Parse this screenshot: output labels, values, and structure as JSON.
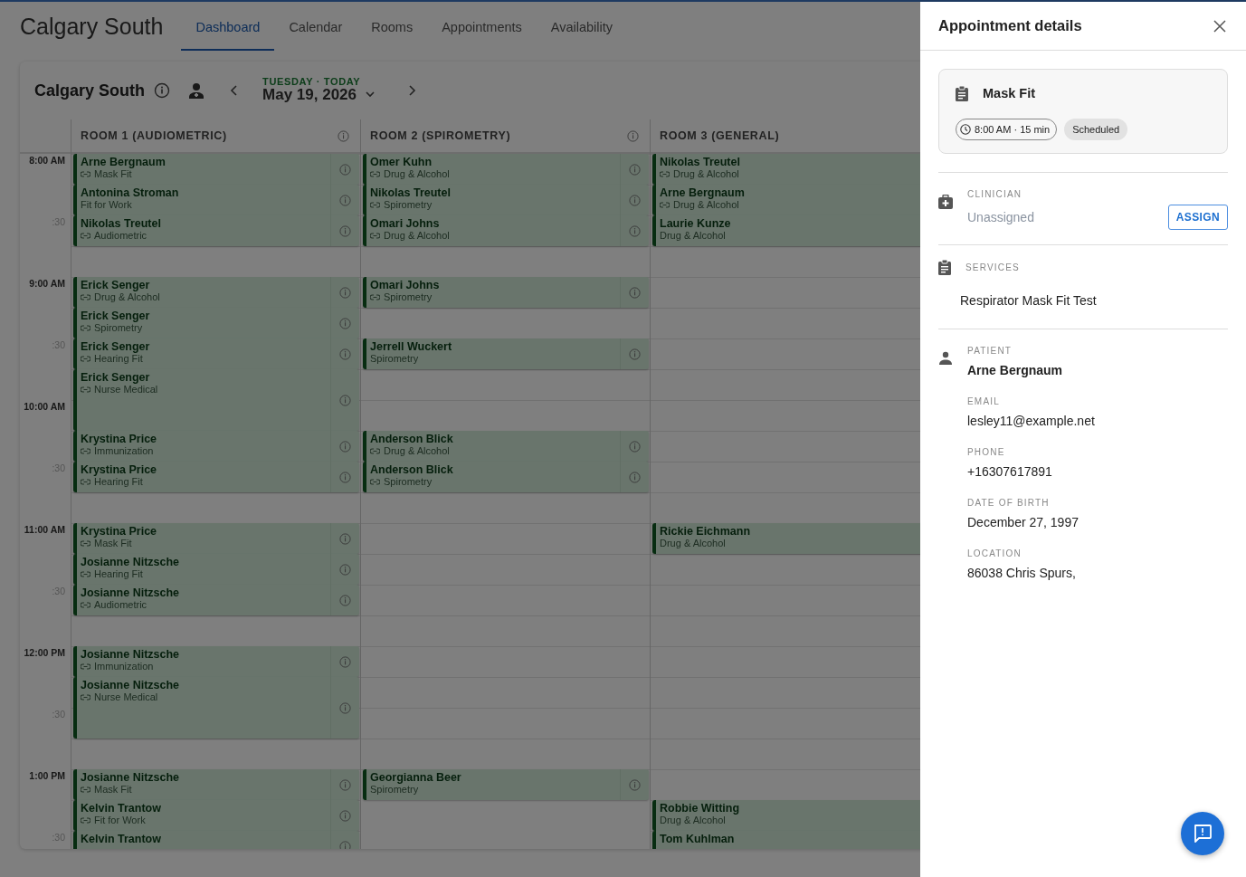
{
  "header": {
    "site_title": "Calgary South"
  },
  "tabs": [
    {
      "label": "Dashboard",
      "selected": true
    },
    {
      "label": "Calendar",
      "selected": false
    },
    {
      "label": "Rooms",
      "selected": false
    },
    {
      "label": "Appointments",
      "selected": false
    },
    {
      "label": "Availability",
      "selected": false
    }
  ],
  "calendar": {
    "location": "Calgary South",
    "day_label": "TUESDAY · TODAY",
    "date": "May 19, 2026",
    "times": [
      {
        "label": "8:00 AM",
        "kind": "hour"
      },
      {
        "label": ":30",
        "kind": "half"
      },
      {
        "label": "9:00 AM",
        "kind": "hour"
      },
      {
        "label": ":30",
        "kind": "half"
      },
      {
        "label": "10:00 AM",
        "kind": "hour"
      },
      {
        "label": ":30",
        "kind": "half"
      },
      {
        "label": "11:00 AM",
        "kind": "hour"
      },
      {
        "label": ":30",
        "kind": "half"
      },
      {
        "label": "12:00 PM",
        "kind": "hour"
      },
      {
        "label": ":30",
        "kind": "half"
      },
      {
        "label": "1:00 PM",
        "kind": "hour"
      },
      {
        "label": ":30",
        "kind": "half"
      }
    ],
    "rooms": [
      {
        "name": "ROOM 1 (AUDIOMETRIC)",
        "info": true,
        "items": [
          {
            "kind": "appointment",
            "patient": "Arne Bergnaum",
            "service": "Mask Fit",
            "linked": true,
            "long": false
          },
          {
            "kind": "appointment",
            "patient": "Antonina Stroman",
            "service": "Fit for Work",
            "linked": false,
            "long": false
          },
          {
            "kind": "appointment",
            "patient": "Nikolas Treutel",
            "service": "Audiometric",
            "linked": true,
            "long": false
          },
          {
            "kind": "gap"
          },
          {
            "kind": "appointment",
            "patient": "Erick Senger",
            "service": "Drug & Alcohol",
            "linked": true,
            "long": false
          },
          {
            "kind": "appointment",
            "patient": "Erick Senger",
            "service": "Spirometry",
            "linked": true,
            "long": false
          },
          {
            "kind": "appointment",
            "patient": "Erick Senger",
            "service": "Hearing Fit",
            "linked": true,
            "long": false
          },
          {
            "kind": "appointment",
            "patient": "Erick Senger",
            "service": "Nurse Medical",
            "linked": true,
            "long": true
          },
          {
            "kind": "appointment",
            "patient": "Krystina Price",
            "service": "Immunization",
            "linked": true,
            "long": false
          },
          {
            "kind": "appointment",
            "patient": "Krystina Price",
            "service": "Hearing Fit",
            "linked": true,
            "long": false
          },
          {
            "kind": "gap"
          },
          {
            "kind": "appointment",
            "patient": "Krystina Price",
            "service": "Mask Fit",
            "linked": true,
            "long": false
          },
          {
            "kind": "appointment",
            "patient": "Josianne Nitzsche",
            "service": "Hearing Fit",
            "linked": true,
            "long": false
          },
          {
            "kind": "appointment",
            "patient": "Josianne Nitzsche",
            "service": "Audiometric",
            "linked": true,
            "long": false
          },
          {
            "kind": "gap"
          },
          {
            "kind": "appointment",
            "patient": "Josianne Nitzsche",
            "service": "Immunization",
            "linked": true,
            "long": false
          },
          {
            "kind": "appointment",
            "patient": "Josianne Nitzsche",
            "service": "Nurse Medical",
            "linked": true,
            "long": true
          },
          {
            "kind": "gap"
          },
          {
            "kind": "appointment",
            "patient": "Josianne Nitzsche",
            "service": "Mask Fit",
            "linked": true,
            "long": false
          },
          {
            "kind": "appointment",
            "patient": "Kelvin Trantow",
            "service": "Fit for Work",
            "linked": true,
            "long": false
          },
          {
            "kind": "appointment",
            "patient": "Kelvin Trantow",
            "long": false
          }
        ]
      },
      {
        "name": "ROOM 2 (SPIROMETRY)",
        "info": true,
        "items": [
          {
            "kind": "appointment",
            "patient": "Omer Kuhn",
            "service": "Drug & Alcohol",
            "linked": true,
            "long": false
          },
          {
            "kind": "appointment",
            "patient": "Nikolas Treutel",
            "service": "Spirometry",
            "linked": true,
            "long": false
          },
          {
            "kind": "appointment",
            "patient": "Omari Johns",
            "service": "Drug & Alcohol",
            "linked": true,
            "long": false
          },
          {
            "kind": "gap"
          },
          {
            "kind": "appointment",
            "patient": "Omari Johns",
            "service": "Spirometry",
            "linked": true,
            "long": false
          },
          {
            "kind": "gap"
          },
          {
            "kind": "appointment",
            "patient": "Jerrell Wuckert",
            "service": "Spirometry",
            "linked": false,
            "long": false
          },
          {
            "kind": "gap"
          },
          {
            "kind": "gap"
          },
          {
            "kind": "appointment",
            "patient": "Anderson Blick",
            "service": "Drug & Alcohol",
            "linked": true,
            "long": false
          },
          {
            "kind": "appointment",
            "patient": "Anderson Blick",
            "service": "Spirometry",
            "linked": true,
            "long": false
          },
          {
            "kind": "gap"
          },
          {
            "kind": "gap"
          },
          {
            "kind": "gap"
          },
          {
            "kind": "gap"
          },
          {
            "kind": "gap"
          },
          {
            "kind": "gap"
          },
          {
            "kind": "gap"
          },
          {
            "kind": "gap"
          },
          {
            "kind": "gap"
          },
          {
            "kind": "appointment",
            "patient": "Georgianna Beer",
            "service": "Spirometry",
            "linked": false,
            "long": false
          }
        ]
      },
      {
        "name": "ROOM 3 (GENERAL)",
        "info": false,
        "items": [
          {
            "kind": "appointment",
            "patient": "Nikolas Treutel",
            "service": "Drug & Alcohol",
            "linked": true,
            "long": false
          },
          {
            "kind": "appointment",
            "patient": "Arne Bergnaum",
            "service": "Drug & Alcohol",
            "linked": true,
            "long": false
          },
          {
            "kind": "appointment",
            "patient": "Laurie Kunze",
            "service": "Drug & Alcohol",
            "linked": false,
            "long": false
          },
          {
            "kind": "gap"
          },
          {
            "kind": "gap"
          },
          {
            "kind": "gap"
          },
          {
            "kind": "gap"
          },
          {
            "kind": "gap"
          },
          {
            "kind": "gap"
          },
          {
            "kind": "gap"
          },
          {
            "kind": "gap"
          },
          {
            "kind": "gap"
          },
          {
            "kind": "appointment",
            "patient": "Rickie Eichmann",
            "service": "Drug & Alcohol",
            "linked": false,
            "long": false
          },
          {
            "kind": "gap"
          },
          {
            "kind": "gap"
          },
          {
            "kind": "gap"
          },
          {
            "kind": "gap"
          },
          {
            "kind": "gap"
          },
          {
            "kind": "gap"
          },
          {
            "kind": "gap"
          },
          {
            "kind": "gap"
          },
          {
            "kind": "appointment",
            "patient": "Robbie Witting",
            "service": "Drug & Alcohol",
            "linked": false,
            "long": false
          },
          {
            "kind": "appointment",
            "patient": "Tom Kuhlman",
            "long": false
          }
        ]
      }
    ]
  },
  "details": {
    "title": "Appointment details",
    "service": "Mask Fit",
    "time": "8:00 AM · 15 min",
    "status": "Scheduled",
    "clinician_label": "CLINICIAN",
    "clinician": "Unassigned",
    "assign_button": "ASSIGN",
    "services_label": "SERVICES",
    "services": "Respirator Mask Fit Test",
    "patient_label": "PATIENT",
    "patient": "Arne Bergnaum",
    "fields": [
      {
        "label": "EMAIL",
        "value": "lesley11@example.net"
      },
      {
        "label": "PHONE",
        "value": "+16307617891"
      },
      {
        "label": "DATE OF BIRTH",
        "value": "December 27, 1997"
      },
      {
        "label": "LOCATION",
        "value": "86038 Chris Spurs,"
      }
    ]
  }
}
